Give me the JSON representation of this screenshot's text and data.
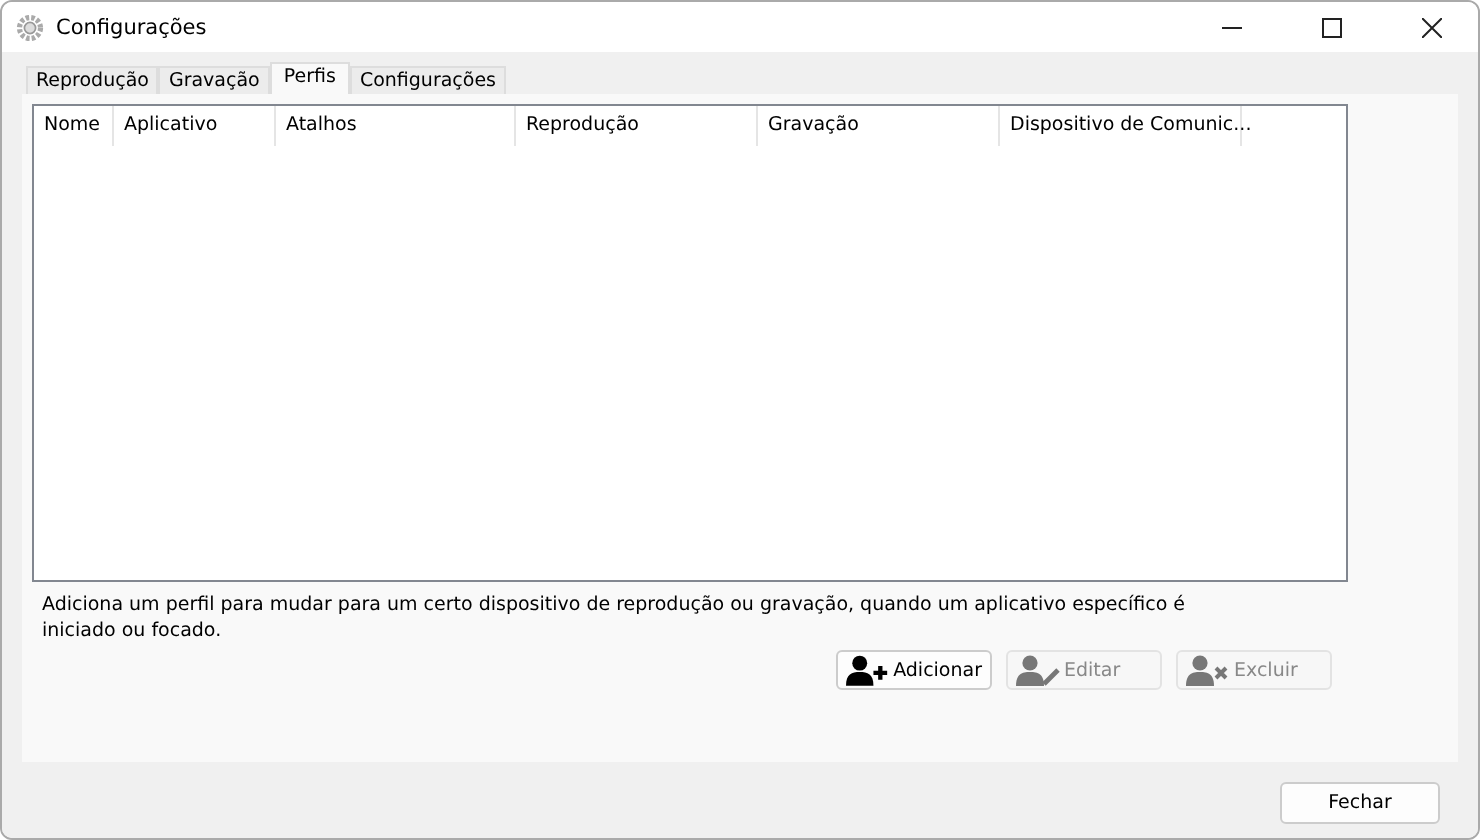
{
  "window": {
    "title": "Configurações"
  },
  "tabs": [
    {
      "label": "Reprodução",
      "selected": false
    },
    {
      "label": "Gravação",
      "selected": false
    },
    {
      "label": "Perfis",
      "selected": true
    },
    {
      "label": "Configurações",
      "selected": false
    }
  ],
  "table": {
    "columns": [
      "Nome",
      "Aplicativo",
      "Atalhos",
      "Reprodução",
      "Gravação",
      "Dispositivo de Comunic..."
    ]
  },
  "description": "Adiciona um perfil para mudar para um certo dispositivo de reprodução ou gravação, quando um aplicativo específico é iniciado ou focado.",
  "actions": [
    {
      "kind": "add",
      "label": "Adicionar",
      "disabled": false
    },
    {
      "kind": "edit",
      "label": "Editar",
      "disabled": true
    },
    {
      "kind": "delete",
      "label": "Excluir",
      "disabled": true
    }
  ],
  "footer_button": "Fechar"
}
